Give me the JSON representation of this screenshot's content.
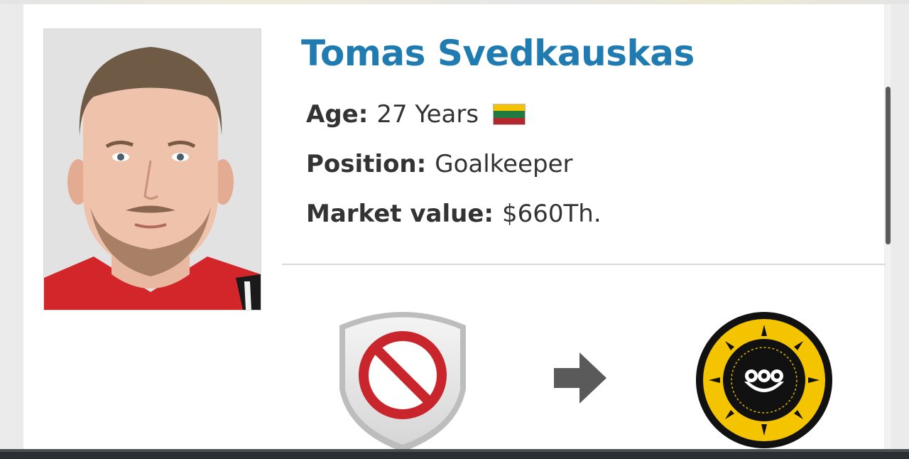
{
  "player": {
    "name": "Tomas Svedkauskas",
    "photo_alt": "player-photo"
  },
  "info": {
    "age_label": "Age:",
    "age_value": "27 Years",
    "nationality_flag": "lithuania-flag",
    "position_label": "Position:",
    "position_value": "Goalkeeper",
    "market_value_label": "Market value:",
    "market_value_value": "$660Th."
  },
  "transfer": {
    "from_club_icon": "no-club-shield-icon",
    "arrow_icon": "right-arrow-icon",
    "to_club_icon": "sepahan-club-logo"
  },
  "colors": {
    "name": "#1f7bb0",
    "text": "#333333",
    "divider": "#d9d9d9",
    "no_club_red": "#c9252c",
    "club_yellow": "#f5c400"
  }
}
